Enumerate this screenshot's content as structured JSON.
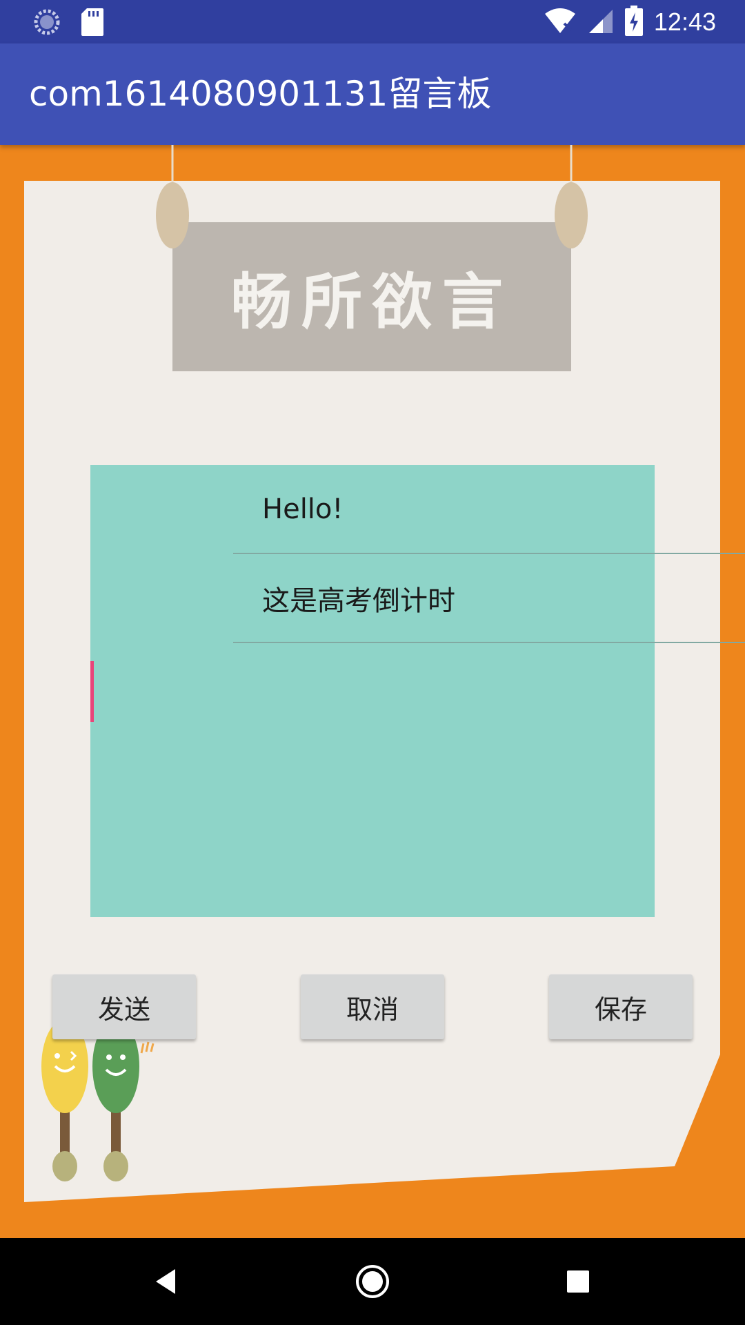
{
  "status_bar": {
    "time": "12:43",
    "icons": [
      "sync-icon",
      "sd-card-icon",
      "wifi-off-icon",
      "signal-icon",
      "battery-charging-icon"
    ]
  },
  "app_bar": {
    "title": "com1614080901131留言板"
  },
  "sign": {
    "text": "畅所欲言"
  },
  "messages": [
    {
      "text": "Hello!"
    },
    {
      "text": "这是高考倒计时"
    }
  ],
  "buttons": {
    "send": "发送",
    "cancel": "取消",
    "save": "保存"
  },
  "nav_bar": {
    "icons": [
      "back-icon",
      "home-icon",
      "recents-icon"
    ]
  },
  "colors": {
    "status_bar": "#303f9f",
    "app_bar": "#3f51b5",
    "background_orange": "#ee861c",
    "paper": "#f1ede8",
    "message_area": "#8ed4c8",
    "sign_board": "#bcb6af",
    "button": "#d6d7d7",
    "cursor": "#e8457a"
  }
}
